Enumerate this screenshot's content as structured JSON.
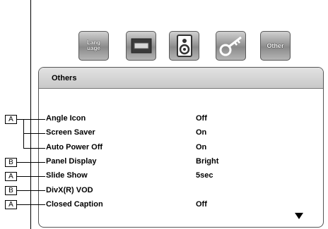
{
  "tabs": [
    {
      "label": "Lang\nuage",
      "icon": "language-icon"
    },
    {
      "label": "",
      "icon": "display-icon"
    },
    {
      "label": "",
      "icon": "speaker-icon"
    },
    {
      "label": "",
      "icon": "key-icon"
    },
    {
      "label": "Other",
      "icon": "other-icon"
    }
  ],
  "panel": {
    "title": "Others",
    "items": [
      {
        "label": "Angle Icon",
        "value": "Off",
        "tag": "A"
      },
      {
        "label": "Screen Saver",
        "value": "On",
        "tag": "A"
      },
      {
        "label": "Auto Power Off",
        "value": "On",
        "tag": "A"
      },
      {
        "label": "Panel Display",
        "value": "Bright",
        "tag": "B"
      },
      {
        "label": "Slide Show",
        "value": "5sec",
        "tag": "A"
      },
      {
        "label": "DivX(R) VOD",
        "value": "",
        "tag": "B"
      },
      {
        "label": "Closed Caption",
        "value": "Off",
        "tag": "A"
      }
    ]
  },
  "annotations": [
    "A",
    "B",
    "A",
    "B",
    "A"
  ]
}
